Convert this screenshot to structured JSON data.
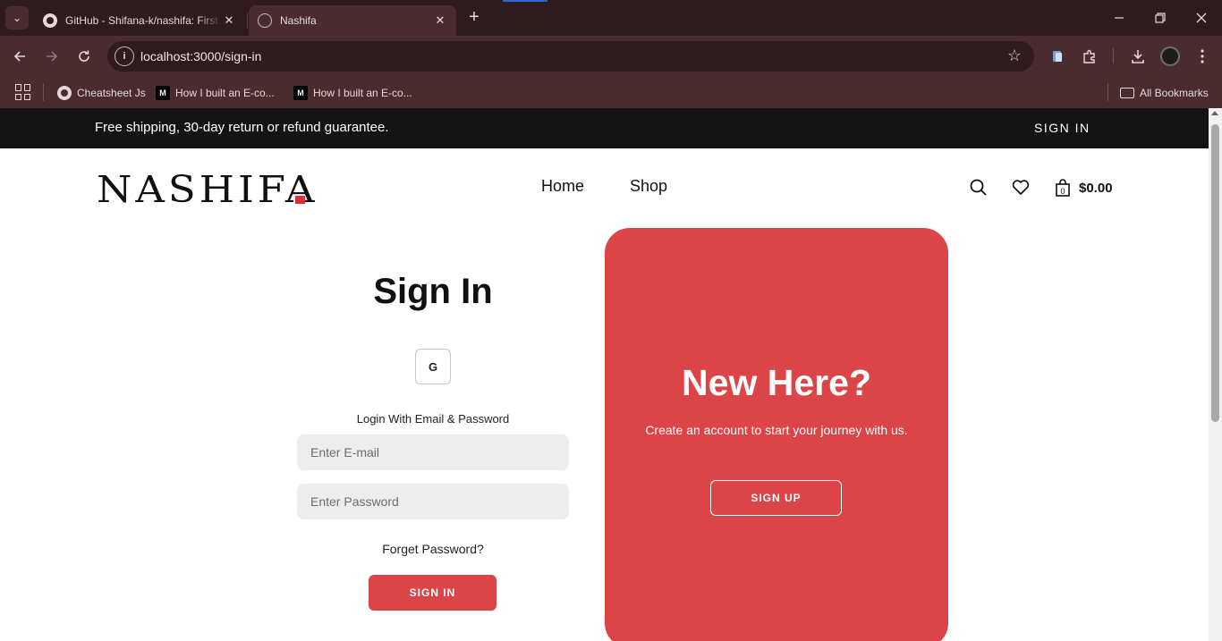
{
  "browser": {
    "tabs": [
      {
        "title": "GitHub - Shifana-k/nashifa: First",
        "active": false
      },
      {
        "title": "Nashifa",
        "active": true
      }
    ],
    "tab_close_glyph": "✕",
    "new_tab_glyph": "+",
    "url": "localhost:3000/sign-in",
    "bookmarks": [
      {
        "label": "Cheatsheet Js",
        "icon": "github-icon"
      },
      {
        "label": "How I built an E-co...",
        "icon": "medium-icon"
      },
      {
        "label": "How I built an E-co...",
        "icon": "medium-icon"
      }
    ],
    "all_bookmarks_label": "All Bookmarks",
    "medium_icon_text": "M"
  },
  "site": {
    "announcement": "Free shipping, 30-day return or refund guarantee.",
    "top_signin": "SIGN IN",
    "logo": "NASHIFA",
    "nav": [
      "Home",
      "Shop"
    ],
    "cart_total": "$0.00",
    "cart_count": "0",
    "accent_color": "#dc4547"
  },
  "signin": {
    "title": "Sign In",
    "google_label": "G",
    "caption": "Login With Email & Password",
    "email_placeholder": "Enter E-mail",
    "password_placeholder": "Enter Password",
    "forget_label": "Forget Password?",
    "button_label": "SIGN IN"
  },
  "promo": {
    "title": "New Here?",
    "text": "Create an account to start your journey with us.",
    "button_label": "SIGN UP"
  }
}
